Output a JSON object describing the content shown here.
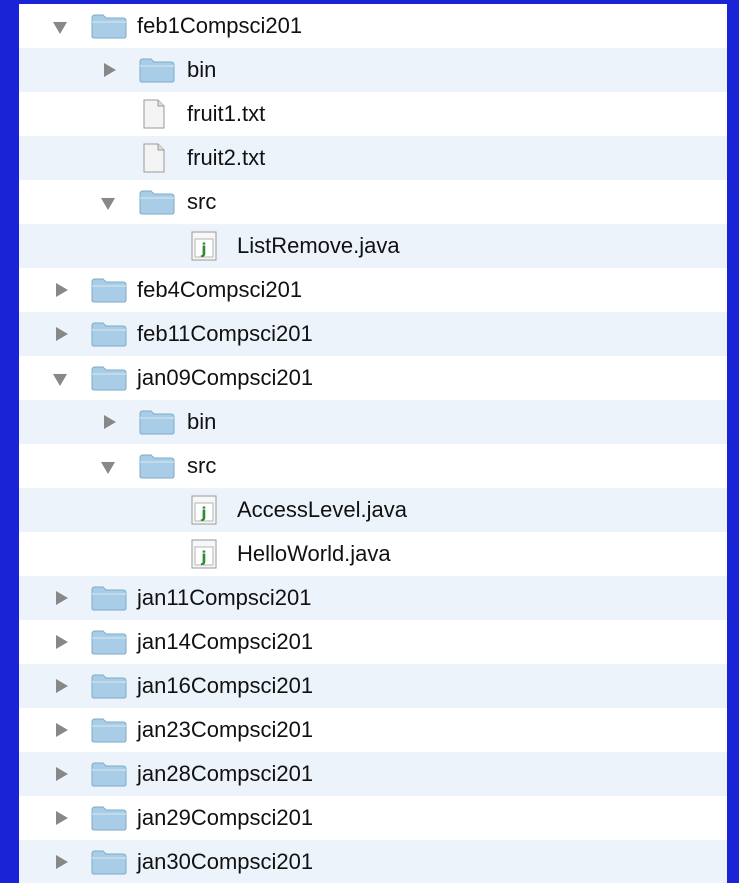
{
  "colors": {
    "background": "#1a23d6",
    "panel": "#ffffff",
    "row_alt": "#edf3fb",
    "folder": "#a9cde6",
    "triangle": "#888888"
  },
  "tree": {
    "rows": [
      {
        "label": "feb1Compsci201",
        "level": 0,
        "kind": "folder",
        "state": "expanded",
        "icon": "folder-icon"
      },
      {
        "label": "bin",
        "level": 1,
        "kind": "folder",
        "state": "collapsed",
        "icon": "folder-icon"
      },
      {
        "label": "fruit1.txt",
        "level": 1,
        "kind": "file",
        "icon": "text-file-icon"
      },
      {
        "label": "fruit2.txt",
        "level": 1,
        "kind": "file",
        "icon": "text-file-icon"
      },
      {
        "label": "src",
        "level": 1,
        "kind": "folder",
        "state": "expanded",
        "icon": "folder-icon"
      },
      {
        "label": "ListRemove.java",
        "level": 2,
        "kind": "java",
        "icon": "java-file-icon"
      },
      {
        "label": "feb4Compsci201",
        "level": 0,
        "kind": "folder",
        "state": "collapsed",
        "icon": "folder-icon"
      },
      {
        "label": "feb11Compsci201",
        "level": 0,
        "kind": "folder",
        "state": "collapsed",
        "icon": "folder-icon"
      },
      {
        "label": "jan09Compsci201",
        "level": 0,
        "kind": "folder",
        "state": "expanded",
        "icon": "folder-icon"
      },
      {
        "label": "bin",
        "level": 1,
        "kind": "folder",
        "state": "collapsed",
        "icon": "folder-icon"
      },
      {
        "label": "src",
        "level": 1,
        "kind": "folder",
        "state": "expanded",
        "icon": "folder-icon"
      },
      {
        "label": "AccessLevel.java",
        "level": 2,
        "kind": "java",
        "icon": "java-file-icon"
      },
      {
        "label": "HelloWorld.java",
        "level": 2,
        "kind": "java",
        "icon": "java-file-icon"
      },
      {
        "label": "jan11Compsci201",
        "level": 0,
        "kind": "folder",
        "state": "collapsed",
        "icon": "folder-icon"
      },
      {
        "label": "jan14Compsci201",
        "level": 0,
        "kind": "folder",
        "state": "collapsed",
        "icon": "folder-icon"
      },
      {
        "label": "jan16Compsci201",
        "level": 0,
        "kind": "folder",
        "state": "collapsed",
        "icon": "folder-icon"
      },
      {
        "label": "jan23Compsci201",
        "level": 0,
        "kind": "folder",
        "state": "collapsed",
        "icon": "folder-icon"
      },
      {
        "label": "jan28Compsci201",
        "level": 0,
        "kind": "folder",
        "state": "collapsed",
        "icon": "folder-icon"
      },
      {
        "label": "jan29Compsci201",
        "level": 0,
        "kind": "folder",
        "state": "collapsed",
        "icon": "folder-icon"
      },
      {
        "label": "jan30Compsci201",
        "level": 0,
        "kind": "folder",
        "state": "collapsed",
        "icon": "folder-icon"
      }
    ]
  }
}
